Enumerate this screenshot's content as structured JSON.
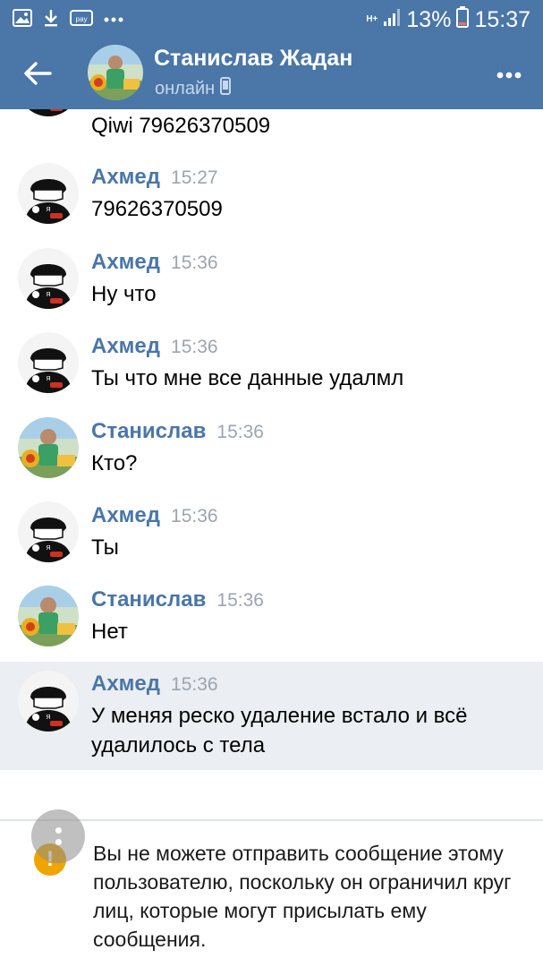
{
  "status_bar": {
    "network": "H+",
    "battery_percent": "13%",
    "time": "15:37"
  },
  "header": {
    "contact_name": "Станислав Жадан",
    "status": "онлайн"
  },
  "messages": [
    {
      "author": "",
      "time": "",
      "text": "Qiwi 79626370509",
      "avatar": "akhmed"
    },
    {
      "author": "Ахмед",
      "time": "15:27",
      "text": "79626370509",
      "avatar": "akhmed"
    },
    {
      "author": "Ахмед",
      "time": "15:36",
      "text": "Ну что",
      "avatar": "akhmed"
    },
    {
      "author": "Ахмед",
      "time": "15:36",
      "text": "Ты что мне все данные удалмл",
      "avatar": "akhmed"
    },
    {
      "author": "Станислав",
      "time": "15:36",
      "text": "Кто?",
      "avatar": "stanislav"
    },
    {
      "author": "Ахмед",
      "time": "15:36",
      "text": "Ты",
      "avatar": "akhmed"
    },
    {
      "author": "Станислав",
      "time": "15:36",
      "text": "Нет",
      "avatar": "stanislav"
    },
    {
      "author": "Ахмед",
      "time": "15:36",
      "text": "У меняя реско удаление встало и всё удалилось с тела",
      "avatar": "akhmed"
    }
  ],
  "notice": {
    "text": "Вы не можете отправить сообщение этому пользователю, поскольку он ограничил круг лиц, которые могут присылать ему сообщения."
  },
  "colors": {
    "header_bg": "#4a76a8",
    "author_name": "#4a76a8",
    "highlight_bg": "#ebeef2",
    "warning": "#f0a400"
  }
}
